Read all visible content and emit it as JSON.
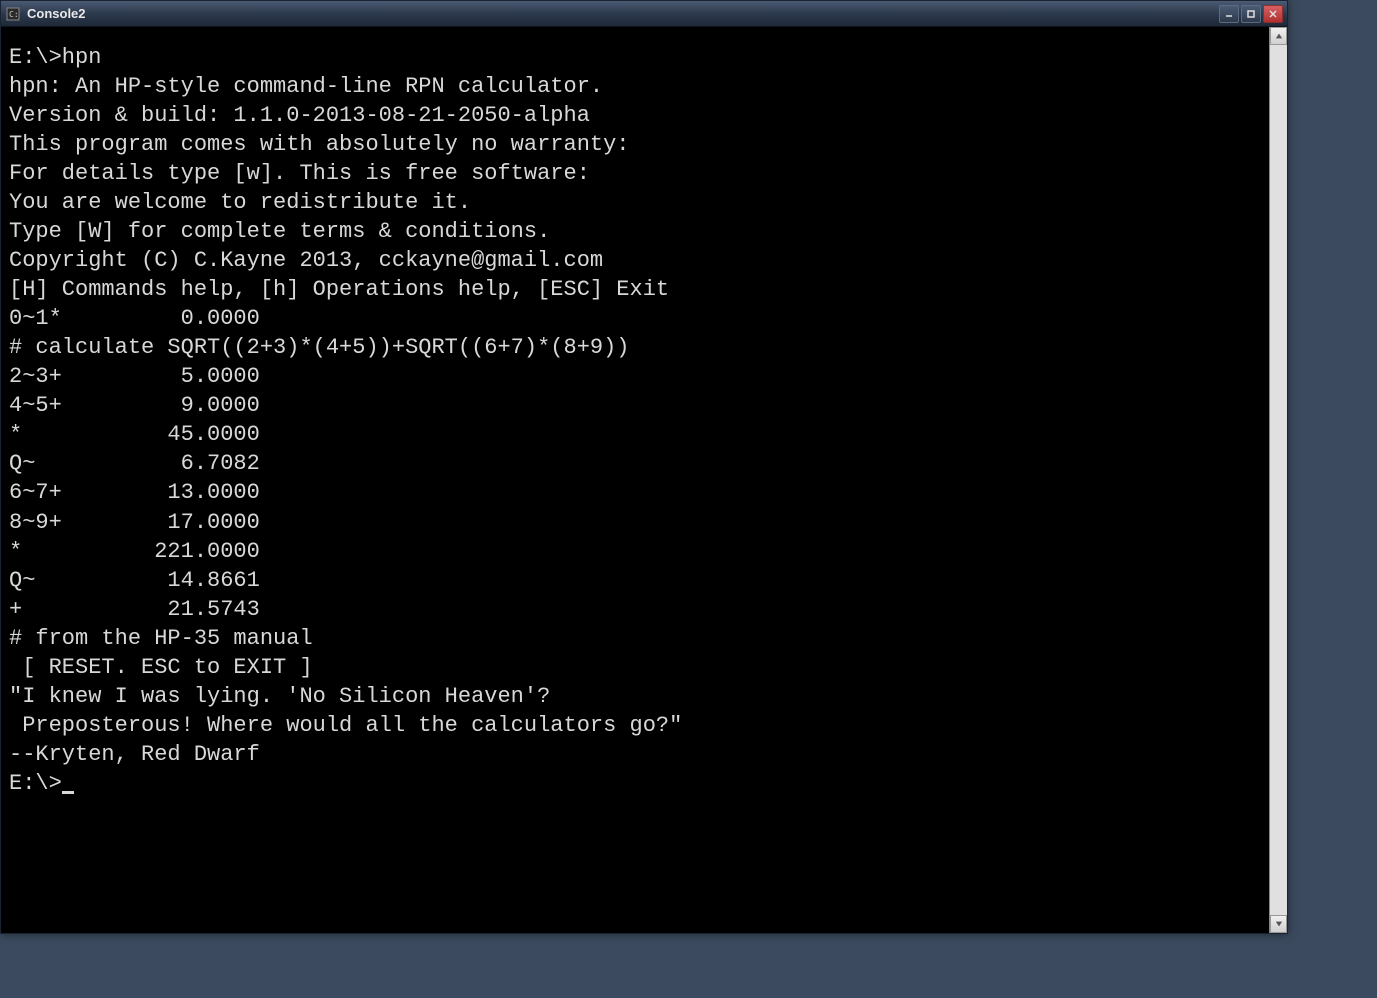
{
  "window": {
    "title": "Console2"
  },
  "terminal": {
    "lines": [
      "E:\\>hpn",
      "hpn: An HP-style command-line RPN calculator.",
      "Version & build: 1.1.0-2013-08-21-2050-alpha",
      "",
      "This program comes with absolutely no warranty:",
      "For details type [w]. This is free software:",
      "You are welcome to redistribute it.",
      "Type [W] for complete terms & conditions.",
      "Copyright (C) C.Kayne 2013, cckayne@gmail.com",
      "",
      "[H] Commands help, [h] Operations help, [ESC] Exit",
      "0~1*         0.0000",
      "# calculate SQRT((2+3)*(4+5))+SQRT((6+7)*(8+9))",
      "2~3+         5.0000",
      "4~5+         9.0000",
      "*           45.0000",
      "Q~           6.7082",
      "6~7+        13.0000",
      "8~9+        17.0000",
      "*          221.0000",
      "Q~          14.8661",
      "+           21.5743",
      "# from the HP-35 manual",
      " [ RESET. ESC to EXIT ]",
      "\"I knew I was lying. 'No Silicon Heaven'?",
      " Preposterous! Where would all the calculators go?\"",
      "--Kryten, Red Dwarf",
      "",
      "E:\\>"
    ]
  }
}
